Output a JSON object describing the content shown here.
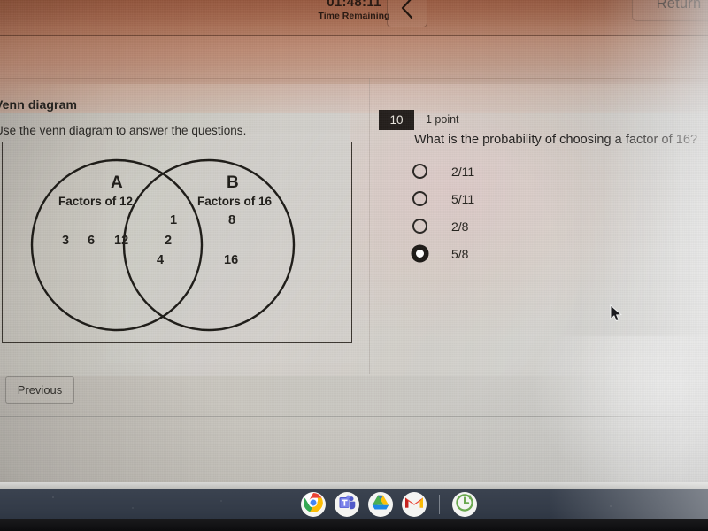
{
  "toolbar": {
    "timer_value": "01:48:11",
    "timer_label": "Time Remaining",
    "back_label": "back-arrow",
    "return_label": "Return"
  },
  "quiz": {
    "title": "Venn diagram",
    "instructions": "Use the venn diagram to answer the questions.",
    "previous_label": "Previous"
  },
  "venn": {
    "set_a_letter": "A",
    "set_a_name": "Factors of 12",
    "set_b_letter": "B",
    "set_b_name": "Factors of 16",
    "a_only": [
      "3",
      "6",
      "12"
    ],
    "intersection": [
      "1",
      "2",
      "4"
    ],
    "b_only": [
      "8",
      "16"
    ]
  },
  "question": {
    "number": "10",
    "points": "1 point",
    "text": "What is the probability of choosing a factor of 16?",
    "options": [
      {
        "label": "2/11",
        "selected": false
      },
      {
        "label": "5/11",
        "selected": false
      },
      {
        "label": "2/8",
        "selected": false
      },
      {
        "label": "5/8",
        "selected": true
      }
    ]
  },
  "shelf": {
    "icons": [
      {
        "name": "chrome-icon",
        "active": true
      },
      {
        "name": "microsoft-teams-icon",
        "active": false
      },
      {
        "name": "google-drive-icon",
        "active": true
      },
      {
        "name": "gmail-icon",
        "active": false
      },
      {
        "name": "clock-refresh-icon",
        "active": true
      }
    ]
  },
  "cursor": {
    "name": "mouse-pointer"
  }
}
